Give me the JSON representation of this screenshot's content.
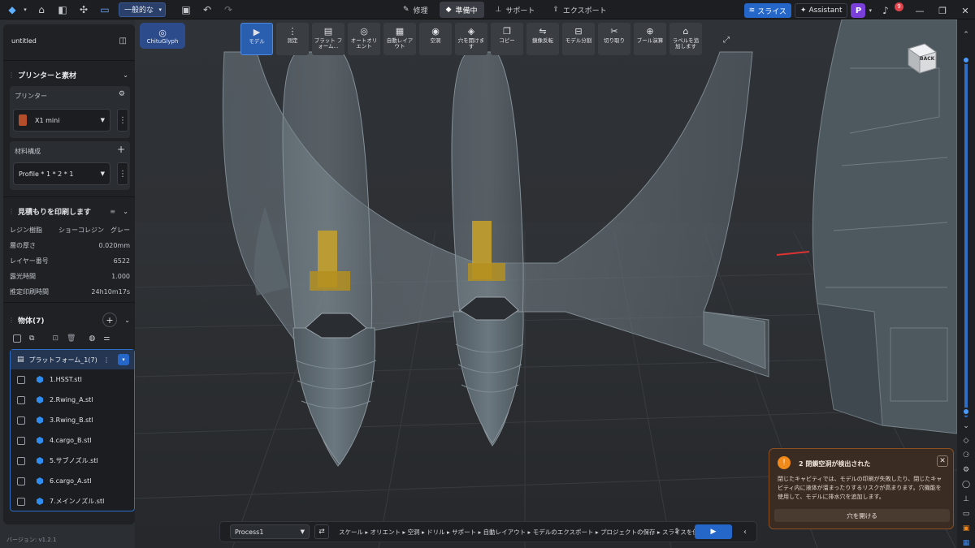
{
  "topbar": {
    "profile_select": "一般的な",
    "tabs": [
      {
        "icon": "repair-icon",
        "label": "修理"
      },
      {
        "icon": "prepare-icon",
        "label": "準備中"
      },
      {
        "icon": "support-icon",
        "label": "サポート"
      },
      {
        "icon": "export-icon",
        "label": "エクスポート"
      }
    ],
    "slice_label": "スライス",
    "assistant_label": "Assistant",
    "plugin_letter": "P",
    "notification_count": "9"
  },
  "brand": {
    "name": "ChituGlyph"
  },
  "toolbar": {
    "tools": [
      {
        "label": "モデル",
        "icon": "▶",
        "active": true
      },
      {
        "label": "測定",
        "icon": "⋮"
      },
      {
        "label": "プラット フォーム...",
        "icon": "▤"
      },
      {
        "label": "オートオリ エント",
        "icon": "◎"
      },
      {
        "label": "自動レイア ウト",
        "icon": "▦"
      },
      {
        "label": "空洞",
        "icon": "◉"
      },
      {
        "label": "穴を開けま す",
        "icon": "◈"
      },
      {
        "label": "コピー",
        "icon": "❐"
      },
      {
        "label": "鏡像反転",
        "icon": "⇋"
      },
      {
        "label": "モデル分割",
        "icon": "⊟"
      },
      {
        "label": "切り取り",
        "icon": "✂"
      },
      {
        "label": "ブール演算",
        "icon": "⊕"
      },
      {
        "label": "ラベルを追 加します",
        "icon": "⌂"
      }
    ]
  },
  "left_panel": {
    "project_name": "untitled",
    "printer_section": {
      "title": "プリンターと素材",
      "printer_label": "プリンター",
      "printer_name": "X1 mini",
      "material_label": "材料構成",
      "material_profile": "Profile * 1 * 2 * 1"
    },
    "estimate_section": {
      "title": "見積もりを印刷します",
      "rows": [
        {
          "label": "レジン樹脂",
          "value": "ショーコレジン　グレー"
        },
        {
          "label": "層の厚さ",
          "value": "0.020mm"
        },
        {
          "label": "レイヤー番号",
          "value": "6522"
        },
        {
          "label": "露光時間",
          "value": "1.000"
        },
        {
          "label": "推定印刷時間",
          "value": "24h10m17s"
        }
      ]
    },
    "objects_section": {
      "title": "物体(7)",
      "platform_label": "プラットフォーム_1(7)",
      "items": [
        "1.HSST.stl",
        "2.Rwing_A.stl",
        "3.Rwing_B.stl",
        "4.cargo_B.stl",
        "5.サブノズル.stl",
        "6.cargo_A.stl",
        "7.メインノズル.stl"
      ]
    },
    "version": "バージョン: v1.2.1"
  },
  "viewcube": {
    "face": "BACK"
  },
  "bottom_bar": {
    "process": "Process1",
    "steps": "スケール ▸ オリエント ▸ 空洞 ▸ ドリル ▸ サポート ▸ 自動レイアウト ▸ モデルのエクスポート ▸ プロジェクトの保存 ▸ スライスを保存"
  },
  "notification": {
    "title": "2 閉鎖空洞が検出された",
    "body": "閉じたキャビティでは、モデルの印刷が失敗したり、閉じたキャビティ内に液体が溜まったりするリスクが高まります。穴機能を使用して、モデルに排水穴を追加します。",
    "button": "穴を開ける"
  },
  "colors": {
    "accent": "#2467c8",
    "warning": "#f08a1a",
    "model": "#5f6b73",
    "support_highlight": "#c9a227"
  }
}
